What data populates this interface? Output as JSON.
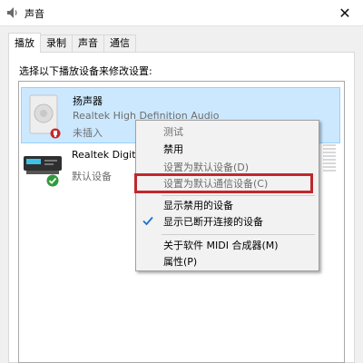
{
  "window": {
    "title": "声音",
    "close_glyph": "✕"
  },
  "tabs": [
    {
      "label": "播放",
      "active": true
    },
    {
      "label": "录制",
      "active": false
    },
    {
      "label": "声音",
      "active": false
    },
    {
      "label": "通信",
      "active": false
    }
  ],
  "instruction": "选择以下播放设备来修改设置:",
  "devices": [
    {
      "name": "扬声器",
      "description": "Realtek High Definition Audio",
      "status": "未插入",
      "icon": "speaker-icon",
      "selected": true
    },
    {
      "name": "Realtek Digital",
      "description": "",
      "status": "默认设备",
      "icon": "digital-output-icon",
      "selected": false
    }
  ],
  "context_menu": {
    "items": [
      {
        "label": "测试",
        "enabled": false
      },
      {
        "label": "禁用",
        "enabled": true
      },
      {
        "label": "设置为默认设备(D)",
        "enabled": false
      },
      {
        "label": "设置为默认通信设备(C)",
        "enabled": false
      },
      {
        "label": "显示禁用的设备",
        "enabled": true
      },
      {
        "label": "显示已断开连接的设备",
        "enabled": true,
        "checked": true
      },
      {
        "label": "关于软件 MIDI 合成器(M)",
        "enabled": true
      },
      {
        "label": "属性(P)",
        "enabled": true
      }
    ]
  },
  "colors": {
    "selection": "#cce8ff",
    "highlight_box": "#c0282d",
    "check": "#1f6fd1",
    "disabled_text": "#6d6d6d"
  }
}
